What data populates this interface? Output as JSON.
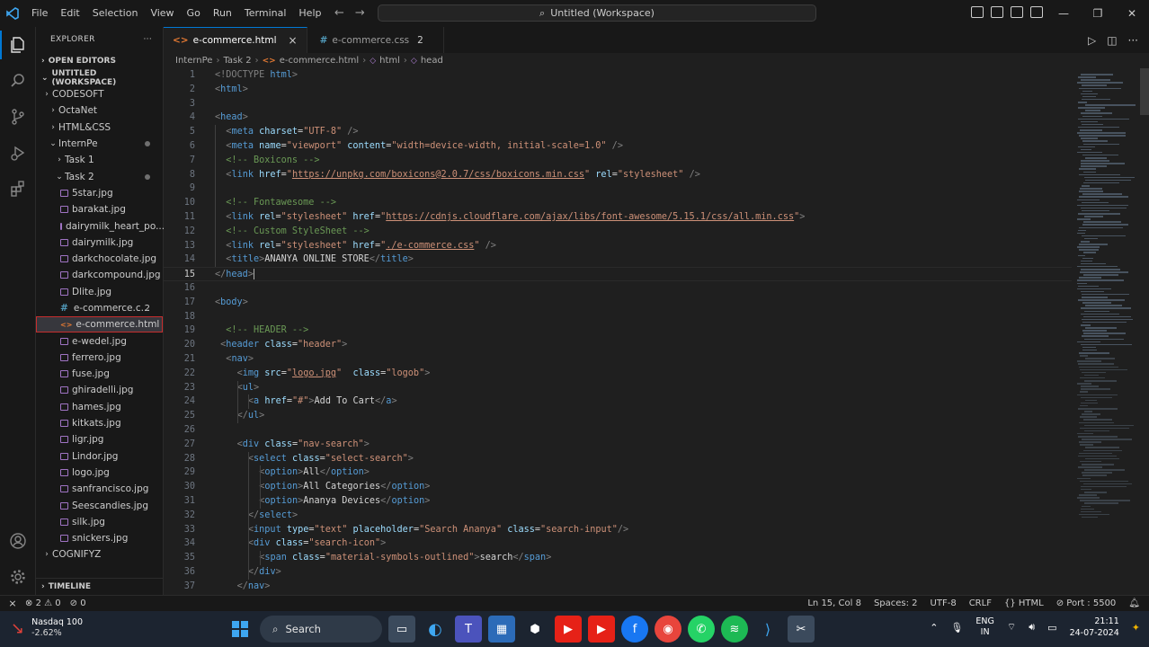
{
  "titlebar": {
    "menu": [
      "File",
      "Edit",
      "Selection",
      "View",
      "Go",
      "Run",
      "Terminal",
      "Help"
    ],
    "command_center": "Untitled (Workspace)",
    "back_icon": "arrow-left-icon",
    "forward_icon": "arrow-right-icon"
  },
  "activity_bar": {
    "items": [
      "explorer-icon",
      "search-icon",
      "source-control-icon",
      "run-debug-icon",
      "extensions-icon"
    ],
    "bottom": [
      "account-icon",
      "settings-gear-icon"
    ]
  },
  "sidebar": {
    "title": "EXPLORER",
    "more": "···",
    "open_editors": "OPEN EDITORS",
    "workspace": "UNTITLED (WORKSPACE)",
    "tree": [
      {
        "label": "CODESOFT",
        "level": 0,
        "chev": "›"
      },
      {
        "label": "OctaNet",
        "level": 1,
        "chev": "›"
      },
      {
        "label": "HTML&CSS",
        "level": 1,
        "chev": "›"
      },
      {
        "label": "InternPe",
        "level": 1,
        "chev": "⌄",
        "dot": true
      },
      {
        "label": "Task 1",
        "level": 2,
        "chev": "›"
      },
      {
        "label": "Task 2",
        "level": 2,
        "chev": "⌄",
        "dot": true
      },
      {
        "label": "5star.jpg",
        "level": 3,
        "type": "img"
      },
      {
        "label": "barakat.jpg",
        "level": 3,
        "type": "img"
      },
      {
        "label": "dairymilk_heart_po...",
        "level": 3,
        "type": "img"
      },
      {
        "label": "dairymilk.jpg",
        "level": 3,
        "type": "img"
      },
      {
        "label": "darkchocolate.jpg",
        "level": 3,
        "type": "img"
      },
      {
        "label": "darkcompound.jpg",
        "level": 3,
        "type": "img"
      },
      {
        "label": "Dlite.jpg",
        "level": 3,
        "type": "img"
      },
      {
        "label": "e-commerce.c...",
        "level": 3,
        "type": "css",
        "count": "2"
      },
      {
        "label": "e-commerce.html",
        "level": 3,
        "type": "html",
        "selected": true
      },
      {
        "label": "e-wedel.jpg",
        "level": 3,
        "type": "img"
      },
      {
        "label": "ferrero.jpg",
        "level": 3,
        "type": "img"
      },
      {
        "label": "fuse.jpg",
        "level": 3,
        "type": "img"
      },
      {
        "label": "ghiradelli.jpg",
        "level": 3,
        "type": "img"
      },
      {
        "label": "hames.jpg",
        "level": 3,
        "type": "img"
      },
      {
        "label": "kitkats.jpg",
        "level": 3,
        "type": "img"
      },
      {
        "label": "ligr.jpg",
        "level": 3,
        "type": "img"
      },
      {
        "label": "Lindor.jpg",
        "level": 3,
        "type": "img"
      },
      {
        "label": "logo.jpg",
        "level": 3,
        "type": "img"
      },
      {
        "label": "sanfrancisco.jpg",
        "level": 3,
        "type": "img"
      },
      {
        "label": "Seescandies.jpg",
        "level": 3,
        "type": "img"
      },
      {
        "label": "silk.jpg",
        "level": 3,
        "type": "img"
      },
      {
        "label": "snickers.jpg",
        "level": 3,
        "type": "img"
      },
      {
        "label": "COGNIFYZ",
        "level": 0,
        "chev": "›"
      }
    ],
    "timeline": "TIMELINE"
  },
  "tabs": [
    {
      "label": "e-commerce.html",
      "icon": "<>",
      "active": true,
      "close": "×"
    },
    {
      "label": "e-commerce.css",
      "icon": "#",
      "active": false,
      "badge": "2"
    }
  ],
  "breadcrumb": [
    "InternPe",
    "Task 2",
    "e-commerce.html",
    "html",
    "head"
  ],
  "code": [
    {
      "n": "1",
      "i": 0,
      "t": [
        [
          "br",
          "<!DOCTYPE "
        ],
        [
          "tag",
          "html"
        ],
        [
          "br",
          ">"
        ]
      ]
    },
    {
      "n": "2",
      "i": 0,
      "t": [
        [
          "br",
          "<"
        ],
        [
          "tag",
          "html"
        ],
        [
          "br",
          ">"
        ]
      ]
    },
    {
      "n": "3",
      "i": 0,
      "t": []
    },
    {
      "n": "4",
      "i": 0,
      "t": [
        [
          "br",
          "<"
        ],
        [
          "tag",
          "head"
        ],
        [
          "br",
          ">"
        ]
      ]
    },
    {
      "n": "5",
      "i": 1,
      "t": [
        [
          "br",
          "<"
        ],
        [
          "tag",
          "meta "
        ],
        [
          "at",
          "charset"
        ],
        [
          "tx",
          "="
        ],
        [
          "st",
          "\"UTF-8\""
        ],
        [
          "br",
          " />"
        ]
      ]
    },
    {
      "n": "6",
      "i": 1,
      "t": [
        [
          "br",
          "<"
        ],
        [
          "tag",
          "meta "
        ],
        [
          "at",
          "name"
        ],
        [
          "tx",
          "="
        ],
        [
          "st",
          "\"viewport\" "
        ],
        [
          "at",
          "content"
        ],
        [
          "tx",
          "="
        ],
        [
          "st",
          "\"width=device-width, initial-scale=1.0\""
        ],
        [
          "br",
          " />"
        ]
      ]
    },
    {
      "n": "7",
      "i": 1,
      "t": [
        [
          "cm",
          "<!-- Boxicons -->"
        ]
      ]
    },
    {
      "n": "8",
      "i": 1,
      "t": [
        [
          "br",
          "<"
        ],
        [
          "tag",
          "link "
        ],
        [
          "at",
          "href"
        ],
        [
          "tx",
          "="
        ],
        [
          "st",
          "\""
        ],
        [
          "lk",
          "https://unpkg.com/boxicons@2.0.7/css/boxicons.min.css"
        ],
        [
          "st",
          "\" "
        ],
        [
          "at",
          "rel"
        ],
        [
          "tx",
          "="
        ],
        [
          "st",
          "\"stylesheet\""
        ],
        [
          "br",
          " />"
        ]
      ]
    },
    {
      "n": "9",
      "i": 0,
      "t": []
    },
    {
      "n": "10",
      "i": 1,
      "t": [
        [
          "cm",
          "<!-- Fontawesome -->"
        ]
      ]
    },
    {
      "n": "11",
      "i": 1,
      "t": [
        [
          "br",
          "<"
        ],
        [
          "tag",
          "link "
        ],
        [
          "at",
          "rel"
        ],
        [
          "tx",
          "="
        ],
        [
          "st",
          "\"stylesheet\" "
        ],
        [
          "at",
          "href"
        ],
        [
          "tx",
          "="
        ],
        [
          "st",
          "\""
        ],
        [
          "lk",
          "https://cdnjs.cloudflare.com/ajax/libs/font-awesome/5.15.1/css/all.min.css"
        ],
        [
          "st",
          "\""
        ],
        [
          "br",
          ">"
        ]
      ]
    },
    {
      "n": "12",
      "i": 1,
      "t": [
        [
          "cm",
          "<!-- Custom StyleSheet -->"
        ]
      ]
    },
    {
      "n": "13",
      "i": 1,
      "t": [
        [
          "br",
          "<"
        ],
        [
          "tag",
          "link "
        ],
        [
          "at",
          "rel"
        ],
        [
          "tx",
          "="
        ],
        [
          "st",
          "\"stylesheet\" "
        ],
        [
          "at",
          "href"
        ],
        [
          "tx",
          "="
        ],
        [
          "st",
          "\""
        ],
        [
          "lk",
          "./e-commerce.css"
        ],
        [
          "st",
          "\""
        ],
        [
          "br",
          " />"
        ]
      ]
    },
    {
      "n": "14",
      "i": 1,
      "t": [
        [
          "br",
          "<"
        ],
        [
          "tag",
          "title"
        ],
        [
          "br",
          ">"
        ],
        [
          "tx",
          "ANANYA ONLINE STORE"
        ],
        [
          "br",
          "</"
        ],
        [
          "tag",
          "title"
        ],
        [
          "br",
          ">"
        ]
      ]
    },
    {
      "n": "15",
      "i": 0,
      "t": [
        [
          "br",
          "</"
        ],
        [
          "tag",
          "head"
        ],
        [
          "br",
          ">"
        ]
      ],
      "cur": true
    },
    {
      "n": "16",
      "i": 0,
      "t": []
    },
    {
      "n": "17",
      "i": 0,
      "t": [
        [
          "br",
          "<"
        ],
        [
          "tag",
          "body"
        ],
        [
          "br",
          ">"
        ]
      ]
    },
    {
      "n": "18",
      "i": 0,
      "t": []
    },
    {
      "n": "19",
      "i": 1,
      "t": [
        [
          "cm",
          "<!-- HEADER -->"
        ]
      ]
    },
    {
      "n": "20",
      "i": 0.5,
      "t": [
        [
          "br",
          "<"
        ],
        [
          "tag",
          "header "
        ],
        [
          "at",
          "class"
        ],
        [
          "tx",
          "="
        ],
        [
          "st",
          "\"header\""
        ],
        [
          "br",
          ">"
        ]
      ]
    },
    {
      "n": "21",
      "i": 1,
      "t": [
        [
          "br",
          "<"
        ],
        [
          "tag",
          "nav"
        ],
        [
          "br",
          ">"
        ]
      ]
    },
    {
      "n": "22",
      "i": 2,
      "t": [
        [
          "br",
          "<"
        ],
        [
          "tag",
          "img "
        ],
        [
          "at",
          "src"
        ],
        [
          "tx",
          "="
        ],
        [
          "st",
          "\""
        ],
        [
          "lk",
          "logo.jpg"
        ],
        [
          "st",
          "\"  "
        ],
        [
          "at",
          "class"
        ],
        [
          "tx",
          "="
        ],
        [
          "st",
          "\"logob\""
        ],
        [
          "br",
          ">"
        ]
      ]
    },
    {
      "n": "23",
      "i": 2,
      "t": [
        [
          "br",
          "<"
        ],
        [
          "tag",
          "ul"
        ],
        [
          "br",
          ">"
        ]
      ]
    },
    {
      "n": "24",
      "i": 3,
      "t": [
        [
          "br",
          "<"
        ],
        [
          "tag",
          "a "
        ],
        [
          "at",
          "href"
        ],
        [
          "tx",
          "="
        ],
        [
          "st",
          "\"#\""
        ],
        [
          "br",
          ">"
        ],
        [
          "tx",
          "Add To Cart"
        ],
        [
          "br",
          "</"
        ],
        [
          "tag",
          "a"
        ],
        [
          "br",
          ">"
        ]
      ]
    },
    {
      "n": "25",
      "i": 2,
      "t": [
        [
          "br",
          "</"
        ],
        [
          "tag",
          "ul"
        ],
        [
          "br",
          ">"
        ]
      ]
    },
    {
      "n": "26",
      "i": 0,
      "t": []
    },
    {
      "n": "27",
      "i": 2,
      "t": [
        [
          "br",
          "<"
        ],
        [
          "tag",
          "div "
        ],
        [
          "at",
          "class"
        ],
        [
          "tx",
          "="
        ],
        [
          "st",
          "\"nav-search\""
        ],
        [
          "br",
          ">"
        ]
      ]
    },
    {
      "n": "28",
      "i": 3,
      "t": [
        [
          "br",
          "<"
        ],
        [
          "tag",
          "select "
        ],
        [
          "at",
          "class"
        ],
        [
          "tx",
          "="
        ],
        [
          "st",
          "\"select-search\""
        ],
        [
          "br",
          ">"
        ]
      ]
    },
    {
      "n": "29",
      "i": 4,
      "t": [
        [
          "br",
          "<"
        ],
        [
          "tag",
          "option"
        ],
        [
          "br",
          ">"
        ],
        [
          "tx",
          "All"
        ],
        [
          "br",
          "</"
        ],
        [
          "tag",
          "option"
        ],
        [
          "br",
          ">"
        ]
      ]
    },
    {
      "n": "30",
      "i": 4,
      "t": [
        [
          "br",
          "<"
        ],
        [
          "tag",
          "option"
        ],
        [
          "br",
          ">"
        ],
        [
          "tx",
          "All Categories"
        ],
        [
          "br",
          "</"
        ],
        [
          "tag",
          "option"
        ],
        [
          "br",
          ">"
        ]
      ]
    },
    {
      "n": "31",
      "i": 4,
      "t": [
        [
          "br",
          "<"
        ],
        [
          "tag",
          "option"
        ],
        [
          "br",
          ">"
        ],
        [
          "tx",
          "Ananya Devices"
        ],
        [
          "br",
          "</"
        ],
        [
          "tag",
          "option"
        ],
        [
          "br",
          ">"
        ]
      ]
    },
    {
      "n": "32",
      "i": 3,
      "t": [
        [
          "br",
          "</"
        ],
        [
          "tag",
          "select"
        ],
        [
          "br",
          ">"
        ]
      ]
    },
    {
      "n": "33",
      "i": 3,
      "t": [
        [
          "br",
          "<"
        ],
        [
          "tag",
          "input "
        ],
        [
          "at",
          "type"
        ],
        [
          "tx",
          "="
        ],
        [
          "st",
          "\"text\" "
        ],
        [
          "at",
          "placeholder"
        ],
        [
          "tx",
          "="
        ],
        [
          "st",
          "\"Search Ananya\" "
        ],
        [
          "at",
          "class"
        ],
        [
          "tx",
          "="
        ],
        [
          "st",
          "\"search-input\""
        ],
        [
          "br",
          "/>"
        ]
      ]
    },
    {
      "n": "34",
      "i": 3,
      "t": [
        [
          "br",
          "<"
        ],
        [
          "tag",
          "div "
        ],
        [
          "at",
          "class"
        ],
        [
          "tx",
          "="
        ],
        [
          "st",
          "\"search-icon\""
        ],
        [
          "br",
          ">"
        ]
      ]
    },
    {
      "n": "35",
      "i": 4,
      "t": [
        [
          "br",
          "<"
        ],
        [
          "tag",
          "span "
        ],
        [
          "at",
          "class"
        ],
        [
          "tx",
          "="
        ],
        [
          "st",
          "\"material-symbols-outlined\""
        ],
        [
          "br",
          ">"
        ],
        [
          "tx",
          "search"
        ],
        [
          "br",
          "</"
        ],
        [
          "tag",
          "span"
        ],
        [
          "br",
          ">"
        ]
      ]
    },
    {
      "n": "36",
      "i": 3,
      "t": [
        [
          "br",
          "</"
        ],
        [
          "tag",
          "div"
        ],
        [
          "br",
          ">"
        ]
      ]
    },
    {
      "n": "37",
      "i": 2,
      "t": [
        [
          "br",
          "</"
        ],
        [
          "tag",
          "nav"
        ],
        [
          "br",
          ">"
        ]
      ]
    }
  ],
  "statusbar": {
    "remote_icon": "remote-icon",
    "errors": "2",
    "warnings": "0",
    "ports": "0",
    "position": "Ln 15, Col 8",
    "spaces": "Spaces: 2",
    "encoding": "UTF-8",
    "eol": "CRLF",
    "language": "HTML",
    "port": "Port : 5500",
    "bell_icon": "bell-icon"
  },
  "taskbar": {
    "stock_name": "Nasdaq 100",
    "stock_change": "-2.62%",
    "search_label": "Search",
    "lang_top": "ENG",
    "lang_bottom": "IN",
    "time": "21:11",
    "date": "24-07-2024"
  }
}
